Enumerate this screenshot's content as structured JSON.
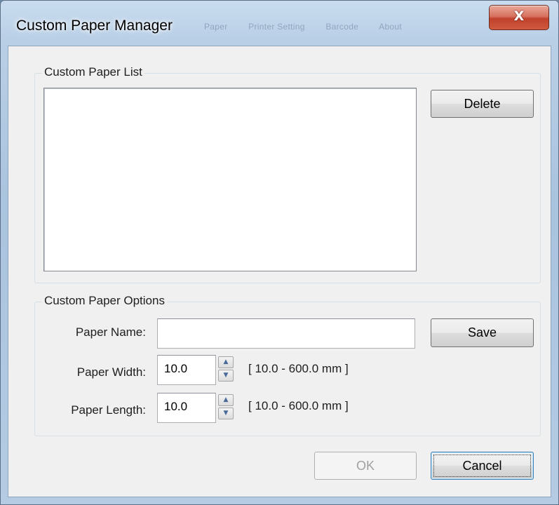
{
  "window": {
    "title": "Custom Paper Manager",
    "close_glyph": "X",
    "background_tabs": [
      "Paper",
      "Printer Setting",
      "Barcode",
      "About"
    ]
  },
  "list_group": {
    "label": "Custom Paper List",
    "items": [],
    "delete_label": "Delete"
  },
  "options_group": {
    "label": "Custom Paper Options",
    "paper_name": {
      "label": "Paper Name:",
      "value": ""
    },
    "save_label": "Save",
    "paper_width": {
      "label": "Paper Width:",
      "value": "10.0",
      "range": "[ 10.0 - 600.0 mm ]"
    },
    "paper_length": {
      "label": "Paper Length:",
      "value": "10.0",
      "range": "[ 10.0 - 600.0 mm ]"
    }
  },
  "footer": {
    "ok_label": "OK",
    "cancel_label": "Cancel"
  },
  "colors": {
    "frame": "#b9cfe6",
    "client": "#f0f0f0",
    "close_button": "#c7402b",
    "default_button_border": "#3c7fb1"
  }
}
